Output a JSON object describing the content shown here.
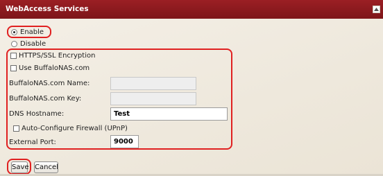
{
  "panel": {
    "title": "WebAccess Services"
  },
  "service_mode": {
    "enable_label": "Enable",
    "disable_label": "Disable",
    "selected": "Enable"
  },
  "options": {
    "https_ssl_label": "HTTPS/SSL Encryption",
    "use_buffalonas_label": "Use BuffaloNAS.com",
    "buffalonas_name_label": "BuffaloNAS.com Name:",
    "buffalonas_name_value": "",
    "buffalonas_key_label": "BuffaloNAS.com Key:",
    "buffalonas_key_value": "",
    "dns_hostname_label": "DNS Hostname:",
    "dns_hostname_value": "Test",
    "upnp_label": "Auto-Configure Firewall (UPnP)",
    "external_port_label": "External Port:",
    "external_port_value": "9000"
  },
  "actions": {
    "save_label": "Save",
    "cancel_label": "Cancel"
  },
  "icons": {
    "collapse": "collapse-up-icon"
  },
  "colors": {
    "header": "#8a1a1e",
    "highlight": "#e02020",
    "background": "#efe9dd"
  }
}
